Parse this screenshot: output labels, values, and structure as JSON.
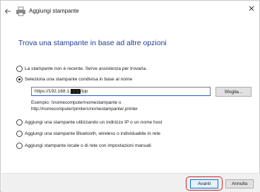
{
  "window": {
    "title": "Aggiungi stampante"
  },
  "heading": "Trova una stampante in base ad altre opzioni",
  "options": [
    {
      "label": "La stampante non è recente. Serve assistenza per trovarla.",
      "checked": false
    },
    {
      "label": "Seleziona una stampante condivisa in base al nome",
      "checked": true
    },
    {
      "label": "Aggiungi una stampante utilizzando un indirizzo IP o un nome host",
      "checked": false
    },
    {
      "label": "Aggiungi una stampante Bluetooth, wireless o individuabile in rete",
      "checked": false
    },
    {
      "label": "Aggiungi stampante locale o di rete con impostazioni manuali",
      "checked": false
    }
  ],
  "shared_printer": {
    "value": "https://192.168.1.███/ipp",
    "browse_label": "Sfoglia...",
    "example_line1": "Esempio: \\\\nomecomputer\\nomestampante o",
    "example_line2": "http://nomecomputer/printers/nomestampante/.printer"
  },
  "footer": {
    "next_label": "Avanti",
    "cancel_label": "Annulla"
  },
  "colors": {
    "heading": "#1f3a93",
    "highlight_ring": "#d9252a",
    "primary_border": "#0078d7"
  },
  "icons": {
    "back": "back-arrow-icon",
    "app": "printer-icon",
    "close": "close-icon"
  }
}
